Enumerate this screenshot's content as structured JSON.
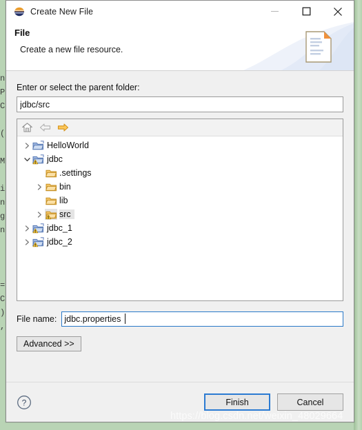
{
  "window": {
    "title": "Create New File",
    "icon": "eclipse-globe-icon",
    "minimize_label": "Minimize",
    "maximize_label": "Maximize",
    "close_label": "Close"
  },
  "banner": {
    "title": "File",
    "subtitle": "Create a new file resource.",
    "icon": "file-document-icon"
  },
  "parent_folder": {
    "label": "Enter or select the parent folder:",
    "value": "jdbc/src"
  },
  "tree_toolbar": {
    "home_label": "Home",
    "back_label": "Back",
    "forward_label": "Forward"
  },
  "tree": {
    "items": [
      {
        "label": "HelloWorld",
        "depth": 0,
        "twisty": "collapsed",
        "icon": "project-folder-icon",
        "warning": false,
        "selected": false
      },
      {
        "label": "jdbc",
        "depth": 0,
        "twisty": "expanded",
        "icon": "project-folder-icon",
        "warning": true,
        "selected": false
      },
      {
        "label": ".settings",
        "depth": 1,
        "twisty": "none",
        "icon": "folder-icon",
        "warning": false,
        "selected": false
      },
      {
        "label": "bin",
        "depth": 1,
        "twisty": "collapsed",
        "icon": "folder-icon",
        "warning": false,
        "selected": false
      },
      {
        "label": "lib",
        "depth": 1,
        "twisty": "none",
        "icon": "folder-icon",
        "warning": false,
        "selected": false
      },
      {
        "label": "src",
        "depth": 1,
        "twisty": "collapsed",
        "icon": "folder-icon",
        "warning": true,
        "selected": true
      },
      {
        "label": "jdbc_1",
        "depth": 0,
        "twisty": "collapsed",
        "icon": "project-folder-icon",
        "warning": true,
        "selected": false
      },
      {
        "label": "jdbc_2",
        "depth": 0,
        "twisty": "collapsed",
        "icon": "project-folder-icon",
        "warning": true,
        "selected": false
      }
    ]
  },
  "file_name": {
    "label": "File name:",
    "value": "jdbc.properties"
  },
  "advanced": {
    "label": "Advanced >>"
  },
  "footer": {
    "help_label": "?",
    "finish_label": "Finish",
    "cancel_label": "Cancel"
  },
  "watermark": {
    "text": "https://blog.csdn.net/weixin_48029664"
  },
  "background": {
    "code_fragment": "n\nP\nC\n\n(\n\nM\n\ni\nn\ng\nn\n\n\n\n=\nC\n)\n,"
  },
  "colors": {
    "dialog_bg": "#f0f0f0",
    "focus_blue": "#2a7ad2",
    "desktop_green": "#bcd6b8",
    "folder_orange": "#e8a33d",
    "warning_yellow": "#f5c342"
  }
}
